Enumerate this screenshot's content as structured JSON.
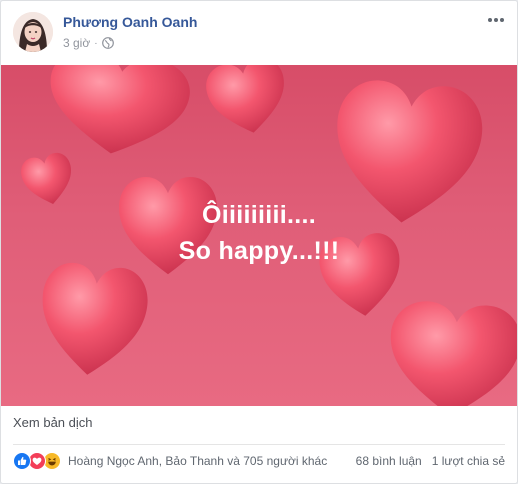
{
  "post": {
    "author": "Phương Oanh Oanh",
    "time": "3 giờ",
    "time_separator": "·",
    "privacy_icon": "globe-icon",
    "more_icon": "ellipsis-icon",
    "image_text_line1": "Ôiiiiiiiii....",
    "image_text_line2": "So happy...!!!",
    "translate_label": "Xem bản dịch"
  },
  "footer": {
    "reaction_icons": [
      "like-icon",
      "love-icon",
      "haha-icon"
    ],
    "reactors": "Hoàng Ngọc Anh, Bảo Thanh và 705 người khác",
    "comments": "68 bình luận",
    "shares": "1 lượt chia sẻ"
  },
  "colors": {
    "author": "#365899",
    "background_top": "#d74d68",
    "background_bottom": "#e86a82",
    "heart": "#ef4f66",
    "like": "#1877f2",
    "love": "#f33e58",
    "haha": "#f7b928"
  }
}
